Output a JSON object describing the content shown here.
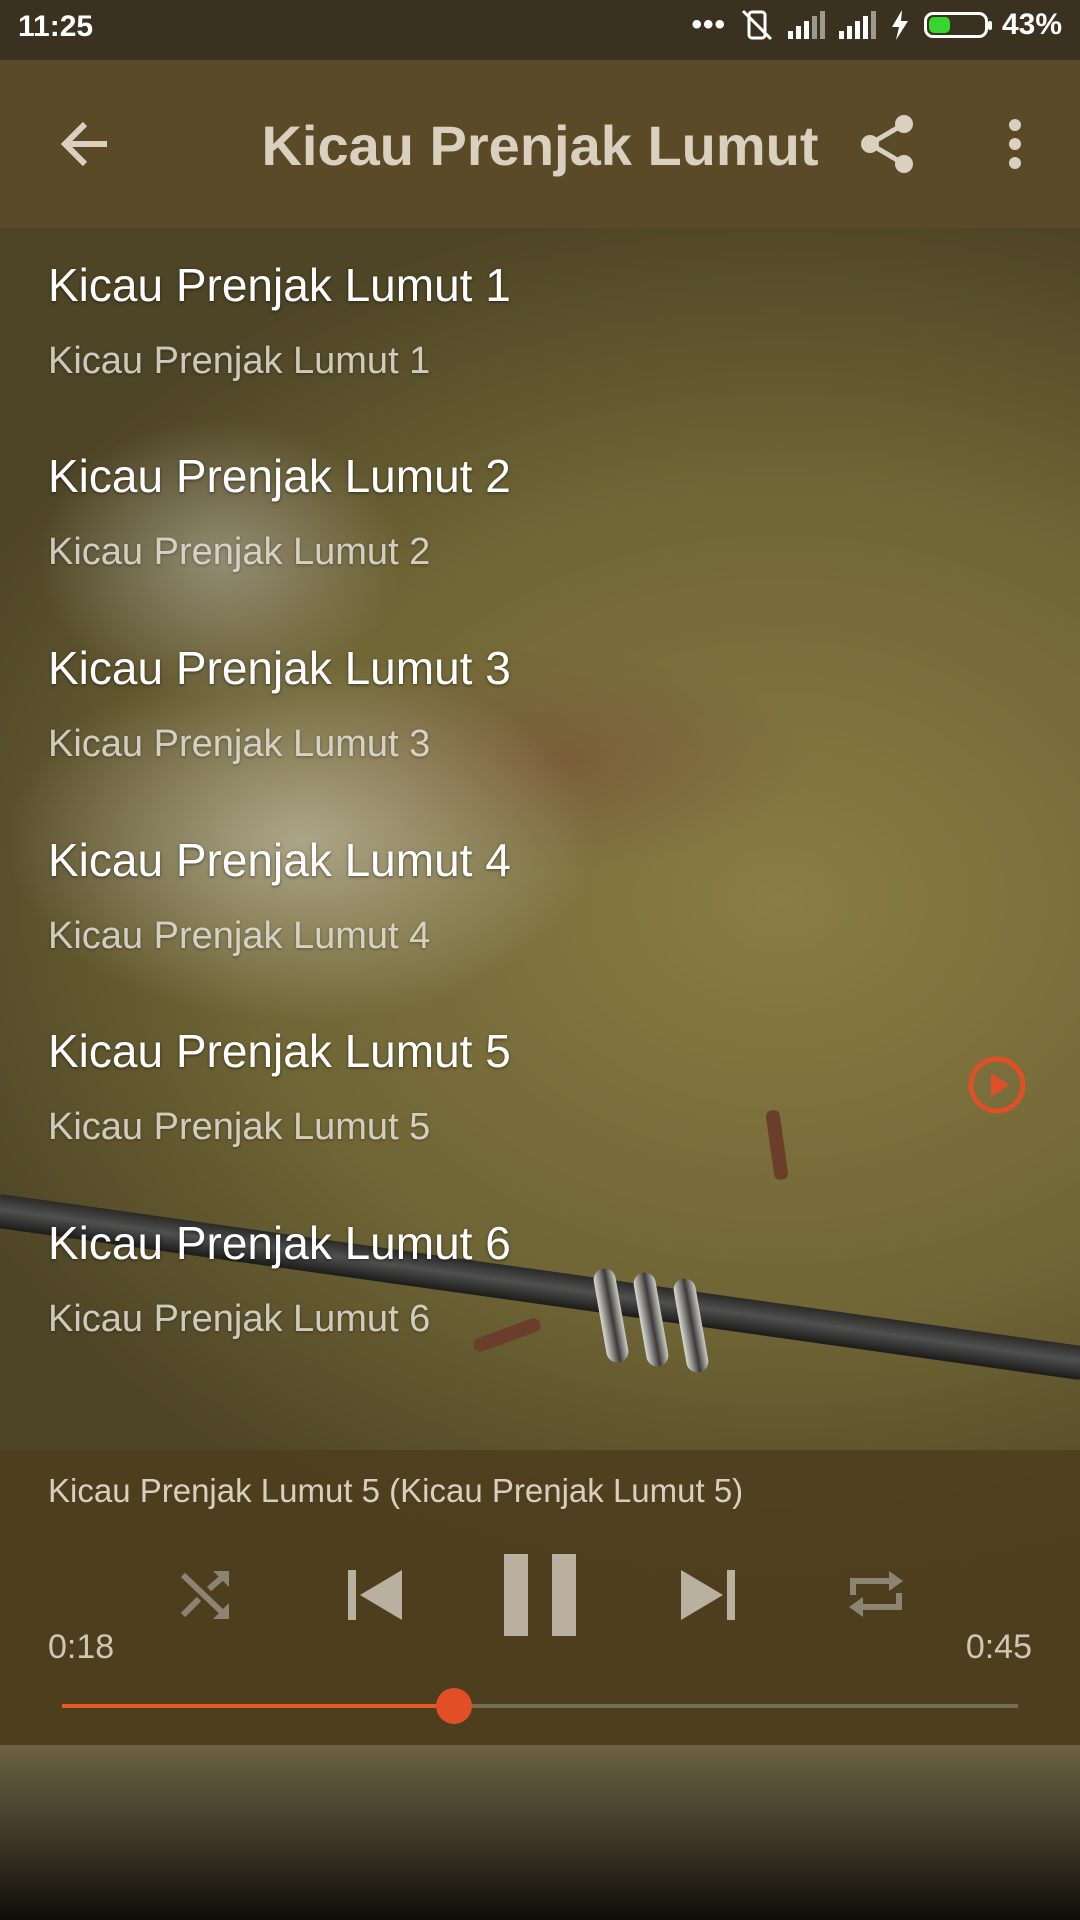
{
  "status_bar": {
    "time": "11:25",
    "battery_percent": "43%",
    "battery_level": 0.43,
    "icons": [
      "more-dots-icon",
      "vibrate-off-icon",
      "signal-icon",
      "signal-icon",
      "charging-icon",
      "battery-icon"
    ]
  },
  "toolbar": {
    "title": "Kicau Prenjak Lumut",
    "back_icon": "arrow-left-icon",
    "share_icon": "share-icon",
    "menu_icon": "more-vertical-icon"
  },
  "tracks": [
    {
      "title": "Kicau Prenjak Lumut 1",
      "subtitle": "Kicau Prenjak Lumut 1",
      "playing": false
    },
    {
      "title": "Kicau Prenjak Lumut 2",
      "subtitle": "Kicau Prenjak Lumut 2",
      "playing": false
    },
    {
      "title": "Kicau Prenjak Lumut 3",
      "subtitle": "Kicau Prenjak Lumut 3",
      "playing": false
    },
    {
      "title": "Kicau Prenjak Lumut 4",
      "subtitle": "Kicau Prenjak Lumut 4",
      "playing": false
    },
    {
      "title": "Kicau Prenjak Lumut 5",
      "subtitle": "Kicau Prenjak Lumut 5",
      "playing": true
    },
    {
      "title": "Kicau Prenjak Lumut 6",
      "subtitle": "Kicau Prenjak Lumut 6",
      "playing": false
    }
  ],
  "player": {
    "now_playing": "Kicau Prenjak Lumut 5 (Kicau Prenjak Lumut 5)",
    "elapsed": "0:18",
    "duration": "0:45",
    "progress": 0.41,
    "controls": [
      "shuffle-icon",
      "previous-icon",
      "pause-icon",
      "next-icon",
      "repeat-icon"
    ]
  },
  "colors": {
    "accent": "#e04f25",
    "toolbar": "#5a4a27",
    "status_bar": "#3b3120"
  }
}
